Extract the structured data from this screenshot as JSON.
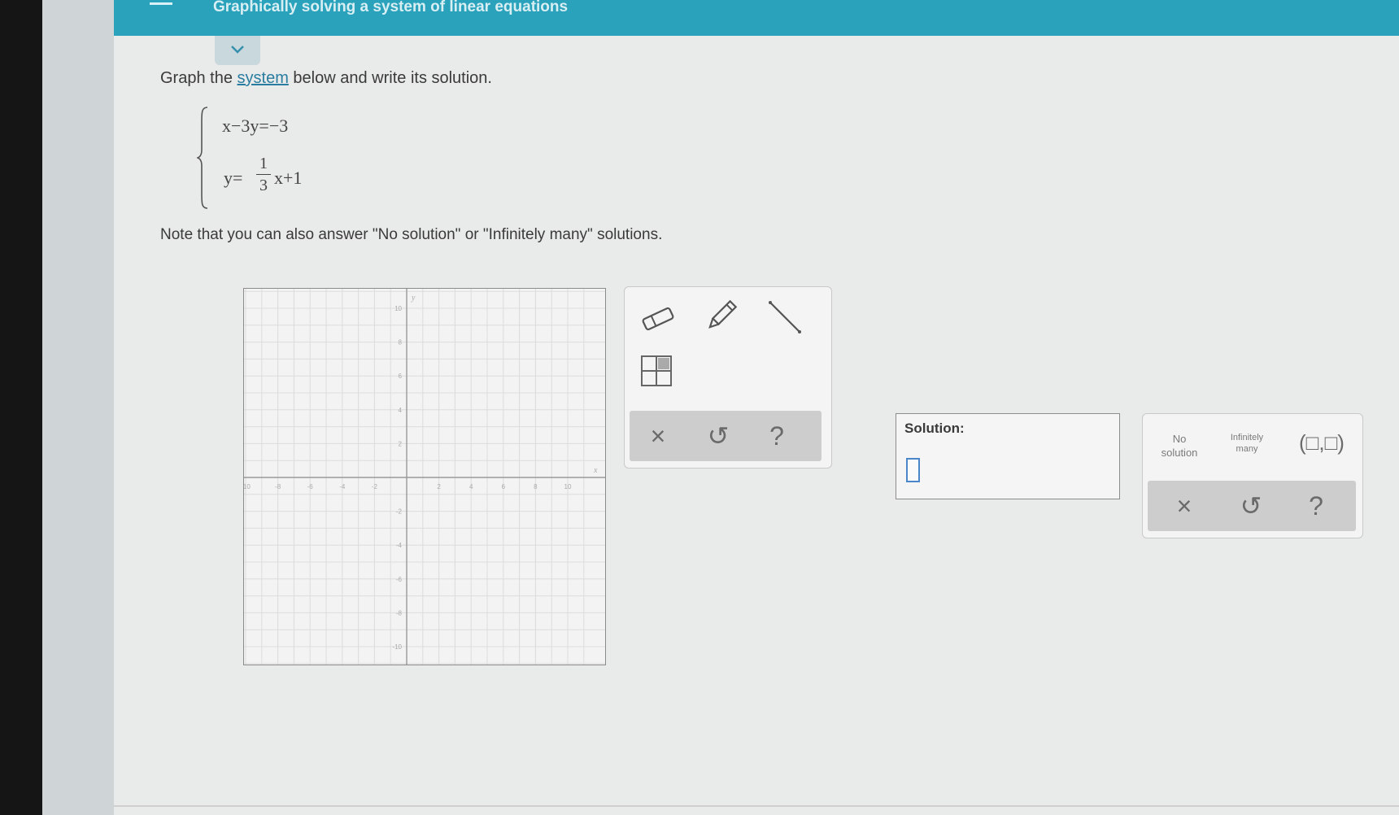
{
  "header": {
    "title": "Graphically solving a system of linear equations",
    "colors": {
      "topbar": "#2aa2bb",
      "link": "#2a7da0",
      "input_focus": "#4a86c9"
    }
  },
  "icons": [
    "menu-icon",
    "chevron-down-icon",
    "eraser-icon",
    "pencil-icon",
    "line-segment-icon",
    "table-icon",
    "close-icon",
    "undo-icon",
    "help-icon"
  ],
  "problem": {
    "prompt_before": "Graph the ",
    "prompt_link": "system",
    "prompt_after": " below and write its solution.",
    "eq1": "x−3y=−3",
    "eq2_lhs": "y=",
    "eq2_num": "1",
    "eq2_den": "3",
    "eq2_rhs": "x+1",
    "note": "Note that you can also answer \"No solution\" or \"Infinitely many\" solutions."
  },
  "graph": {
    "x_axis_label": "x",
    "y_axis_label": "y",
    "x_ticks": [
      "-10",
      "-8",
      "-6",
      "-4",
      "-2",
      "2",
      "4",
      "6",
      "8",
      "10"
    ],
    "y_ticks": [
      "10",
      "8",
      "6",
      "4",
      "2",
      "-2",
      "-4",
      "-6",
      "-8",
      "-10"
    ]
  },
  "tools": {
    "clear_symbol": "×",
    "undo_symbol": "↺",
    "help_symbol": "?"
  },
  "solution": {
    "label": "Solution:"
  },
  "answers": {
    "no_solution_line1": "No",
    "no_solution_line2": "solution",
    "infinitely_line1": "Infinitely",
    "infinitely_line2": "many",
    "pair": "(□,□)",
    "clear_symbol": "×",
    "undo_symbol": "↺",
    "help_symbol": "?"
  }
}
